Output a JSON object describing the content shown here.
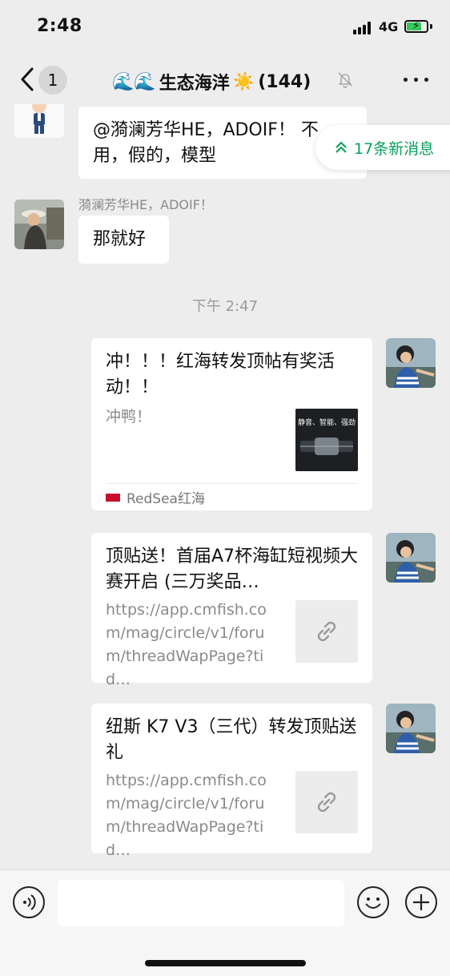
{
  "status_bar": {
    "time": "2:48",
    "network": "4G",
    "battery_level": 0.7
  },
  "nav": {
    "unread_count": "1",
    "title_emoji": "🌊🌊",
    "title": "生态海洋",
    "title_sun": "☀️",
    "member_count": "(144)"
  },
  "new_messages": {
    "label": "17条新消息"
  },
  "messages": [
    {
      "text_line1": "@漪澜芳华HE，ADOIF！  不",
      "text_line2": "用，假的，模型"
    },
    {
      "sender": "漪澜芳华HE，ADOIF！",
      "text": "那就好"
    }
  ],
  "timestamp": "下午 2:47",
  "cards": [
    {
      "title": "冲！！！红海转发顶帖有奖活动！！",
      "desc": "冲鸭！",
      "source": "RedSea红海",
      "thumb_caption": "静音、智能、强劲"
    },
    {
      "title": "顶贴送！首届A7杯海缸短视频大赛开启 (三万奖品…",
      "desc": "https://app.cmfish.com/mag/circle/v1/forum/threadWapPage?tid…"
    },
    {
      "title": "纽斯 K7 V3（三代）转发顶贴送礼",
      "desc": "https://app.cmfish.com/mag/circle/v1/forum/threadWapPage?tid…"
    }
  ],
  "icons": [
    "back-icon",
    "mute-bell-icon",
    "more-icon",
    "double-chevron-up-icon",
    "link-icon",
    "voice-icon",
    "emoji-icon",
    "plus-icon"
  ],
  "colors": {
    "background": "#ededed",
    "accent_green": "#07a05a",
    "bubble": "#ffffff"
  }
}
